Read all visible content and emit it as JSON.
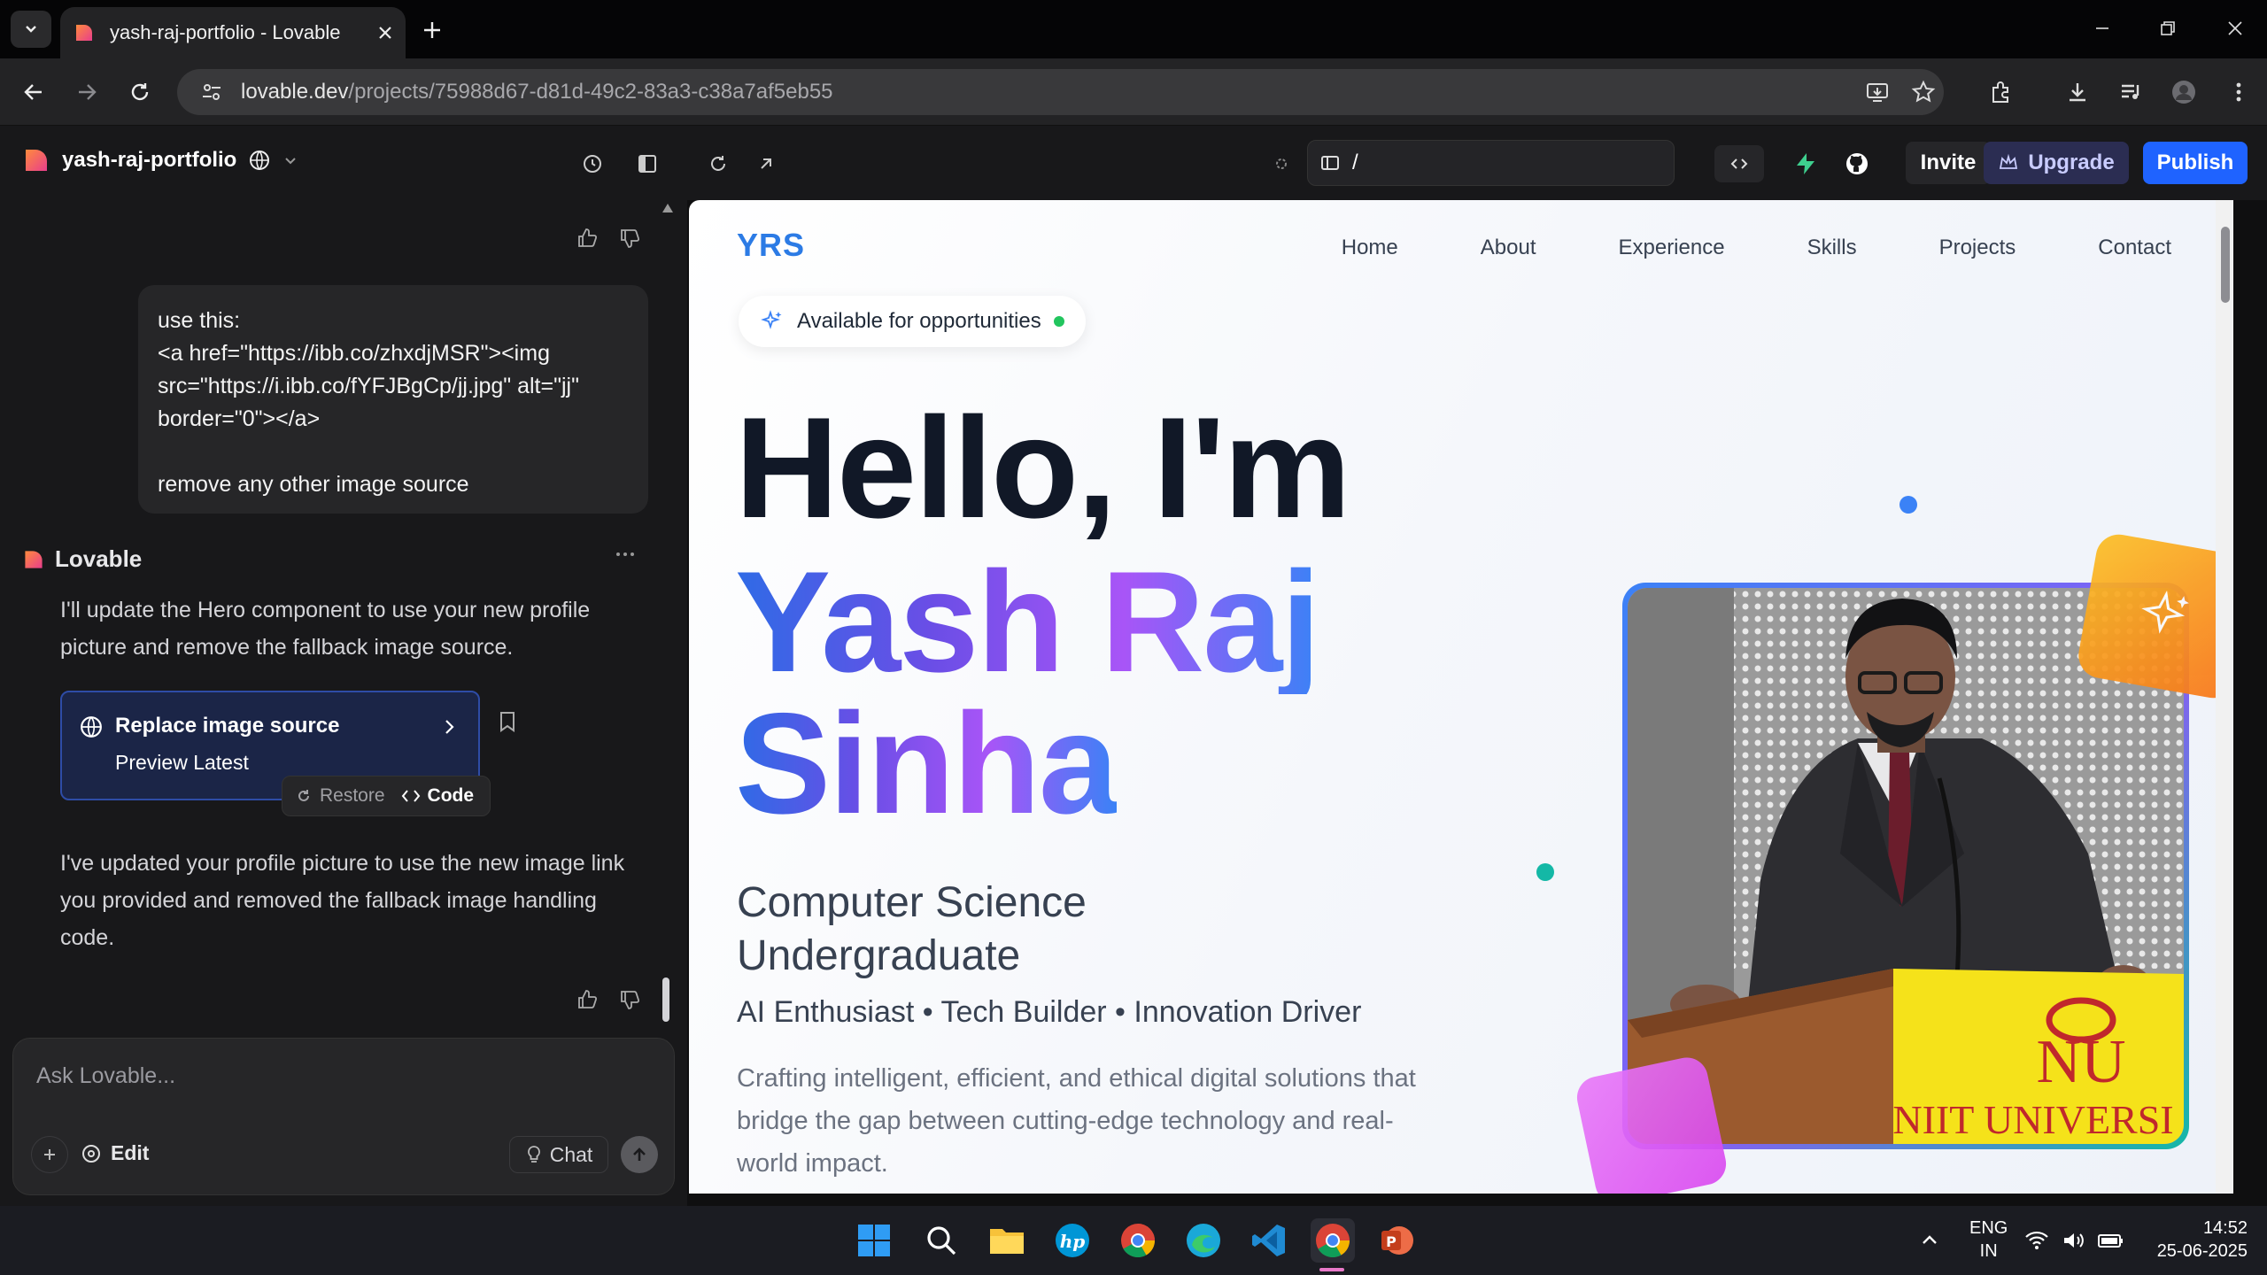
{
  "browser": {
    "tab_title": "yash-raj-portfolio - Lovable",
    "url_host": "lovable.dev",
    "url_path": "/projects/75988d67-d81d-49c2-83a3-c38a7af5eb55"
  },
  "header": {
    "project_name": "yash-raj-portfolio",
    "route": "/",
    "invite_label": "Invite",
    "upgrade_label": "Upgrade",
    "publish_label": "Publish"
  },
  "chat": {
    "user_message": "use this:\n<a href=\"https://ibb.co/zhxdjMSR\"><img src=\"https://i.ibb.co/fYFJBgCp/jj.jpg\" alt=\"jj\" border=\"0\"></a>\n\nremove any other image source",
    "assistant_name": "Lovable",
    "assistant_msg_1": "I'll update the Hero component to use your new profile picture and remove the fallback image source.",
    "card_title": "Replace image source",
    "card_subtitle": "Preview Latest",
    "restore_label": "Restore",
    "code_label": "Code",
    "assistant_msg_2": "I've updated your profile picture to use the new image link you provided and removed the fallback image handling code.",
    "input_placeholder": "Ask Lovable...",
    "edit_label": "Edit",
    "chat_label": "Chat"
  },
  "site": {
    "brand": "YRS",
    "nav": [
      "Home",
      "About",
      "Experience",
      "Skills",
      "Projects",
      "Contact"
    ],
    "badge": "Available for opportunities",
    "hello": "Hello, I'm",
    "name_line1": "Yash Raj",
    "name_line2": "Sinha",
    "role": "Computer Science Undergraduate",
    "tagline": "AI Enthusiast • Tech Builder • Innovation Driver",
    "description": "Crafting intelligent, efficient, and ethical digital solutions that bridge the gap between cutting-edge technology and real-world impact.",
    "podium_logo": "NU",
    "podium_text": "NIIT UNIVERSI"
  },
  "taskbar": {
    "lang_line1": "ENG",
    "lang_line2": "IN",
    "time": "14:52",
    "date": "25-06-2025"
  },
  "colors": {
    "publish": "#1f63ff",
    "brand": "#2c7be5",
    "gradient_start": "#2f6be6",
    "gradient_end": "#a855f7"
  }
}
